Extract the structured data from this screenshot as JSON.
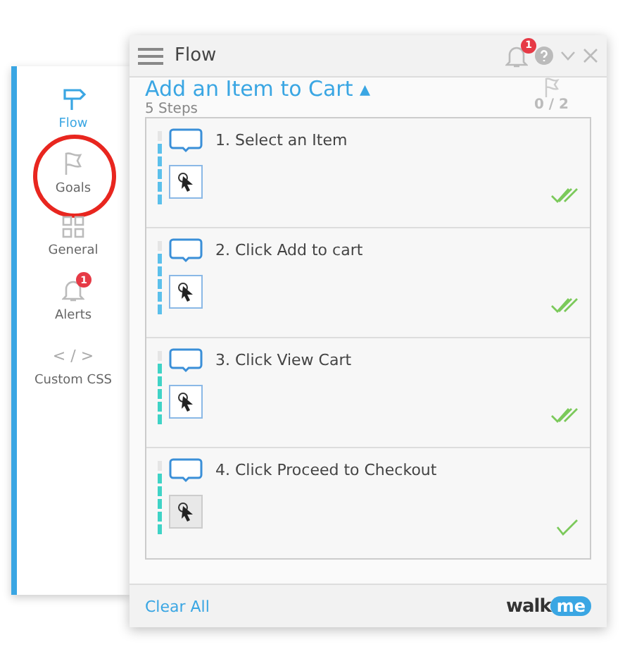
{
  "sidebar": {
    "items": [
      {
        "label": "Flow",
        "kind": "signpost",
        "selected": true,
        "highlighted": false
      },
      {
        "label": "Goals",
        "kind": "flag",
        "selected": false,
        "highlighted": true
      },
      {
        "label": "General",
        "kind": "grid",
        "selected": false,
        "highlighted": false
      },
      {
        "label": "Alerts",
        "kind": "bell",
        "selected": false,
        "highlighted": false,
        "badge": "1"
      },
      {
        "label": "Custom CSS",
        "kind": "code",
        "glyph": "< / >",
        "selected": false,
        "highlighted": false
      }
    ]
  },
  "panel": {
    "title": "Flow",
    "notification_badge": "1",
    "flow_title": "Add an Item to Cart",
    "flow_title_caret": "▴",
    "steps_count": "5 Steps",
    "goals_progress": "0 / 2",
    "steps": [
      {
        "label": "1. Select an Item",
        "color": "#5bc0eb",
        "kind": "completed"
      },
      {
        "label": "2. Click Add to cart",
        "color": "#5bc0eb",
        "kind": "completed"
      },
      {
        "label": "3. Click View Cart",
        "color": "#3fd3c6",
        "kind": "completed"
      },
      {
        "label": "4. Click Proceed to Checkout",
        "color": "#3fd3c6",
        "kind": "current"
      }
    ],
    "footer_link": "Clear All",
    "logo": {
      "word": "walk",
      "bubble": "me"
    }
  }
}
